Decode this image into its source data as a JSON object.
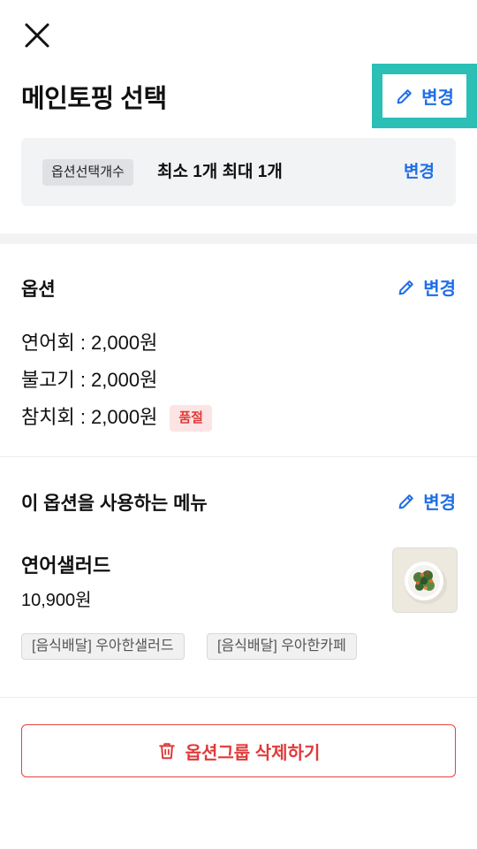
{
  "header": {
    "close_icon": "close-icon",
    "title": "메인토핑 선택",
    "edit_label": "변경"
  },
  "count_setting": {
    "chip_label": "옵션선택개수",
    "value_text": "최소 1개 최대 1개",
    "edit_label": "변경"
  },
  "options_section": {
    "title": "옵션",
    "edit_label": "변경",
    "items": [
      {
        "text": "연어회 : 2,000원",
        "badge": ""
      },
      {
        "text": "불고기 : 2,000원",
        "badge": ""
      },
      {
        "text": "참치회 : 2,000원",
        "badge": "품절"
      }
    ]
  },
  "menus_section": {
    "title": "이 옵션을 사용하는 메뉴",
    "edit_label": "변경",
    "menu": {
      "name": "연어샐러드",
      "price": "10,900원",
      "tags": [
        "[음식배달] 우아한샐러드",
        "[음식배달] 우아한카페"
      ]
    }
  },
  "footer": {
    "delete_label": "옵션그룹 삭제하기",
    "delete_icon": "trash-icon"
  },
  "colors": {
    "accent_blue": "#1f6ee6",
    "highlight_teal": "#2bbfb6",
    "danger_red": "#e03a3a"
  }
}
